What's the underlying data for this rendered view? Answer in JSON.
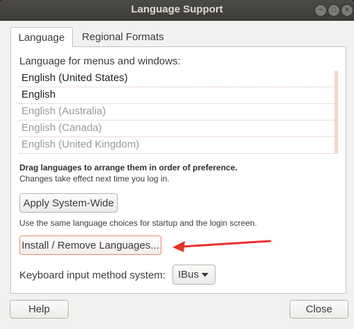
{
  "window": {
    "title": "Language Support",
    "controls": {
      "minimize_icon": "minimize-icon",
      "maximize_icon": "maximize-icon",
      "close_icon": "close-icon"
    }
  },
  "tabs": [
    {
      "label": "Language",
      "selected": true
    },
    {
      "label": "Regional Formats",
      "selected": false
    }
  ],
  "language_tab": {
    "heading": "Language for menus and windows:",
    "languages": [
      {
        "label": "English (United States)",
        "active": true
      },
      {
        "label": "English",
        "active": true
      },
      {
        "label": "English (Australia)",
        "active": false
      },
      {
        "label": "English (Canada)",
        "active": false
      },
      {
        "label": "English (United Kingdom)",
        "active": false
      }
    ],
    "drag_note": "Drag languages to arrange them in order of preference.",
    "changes_note": "Changes take effect next time you log in.",
    "apply_button": "Apply System-Wide",
    "same_choices_note": "Use the same language choices for startup and the login screen.",
    "install_button": "Install / Remove Languages...",
    "keyboard_label": "Keyboard input method system:",
    "keyboard_value": "IBus"
  },
  "footer": {
    "help_button": "Help",
    "close_button": "Close"
  },
  "colors": {
    "annotation_arrow": "#e8312a",
    "titlebar": "#3d3c38",
    "highlight_border": "#e88a6b"
  }
}
